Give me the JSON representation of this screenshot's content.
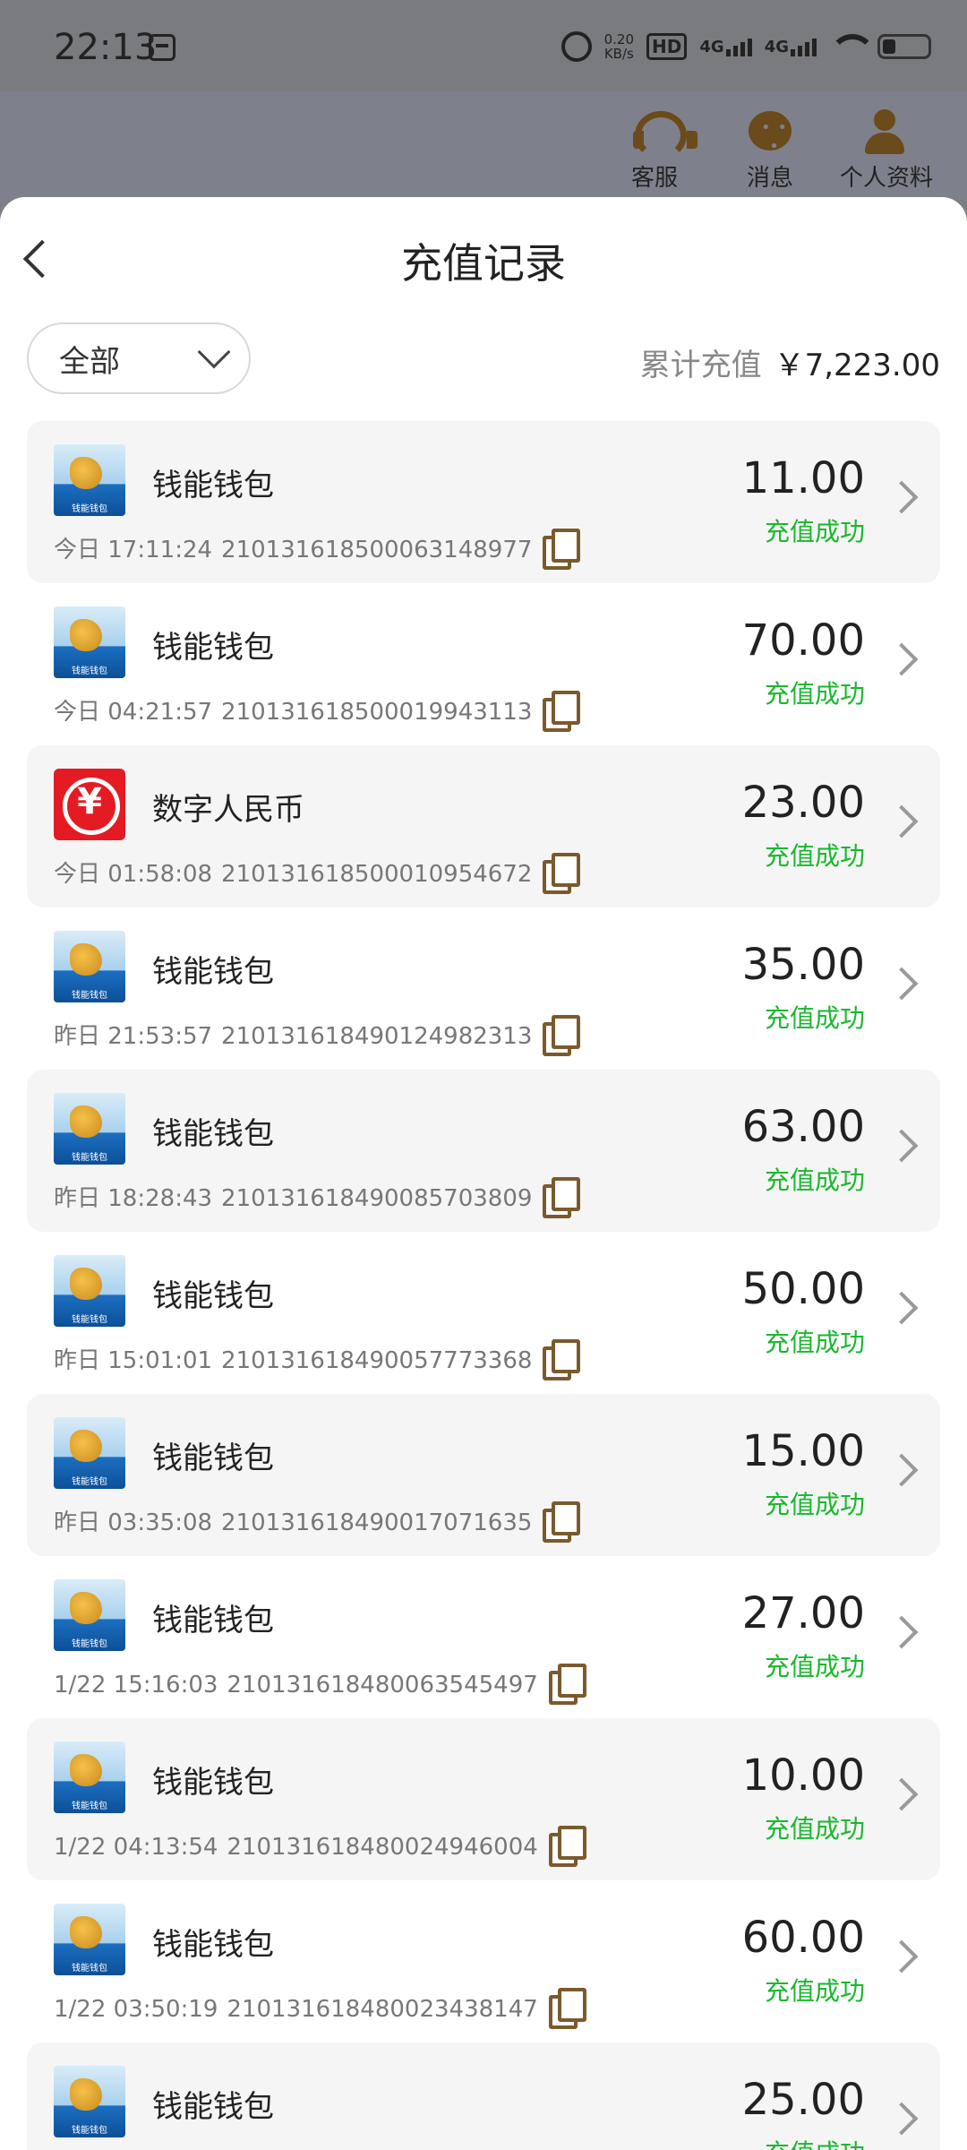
{
  "status_bar": {
    "time": "22:13",
    "net_speed": "0.20",
    "net_unit": "KB/s",
    "hd": "HD",
    "sim1": "4G",
    "sim2": "4G"
  },
  "top_nav": {
    "customer_service": "客服",
    "messages": "消息",
    "profile": "个人资料"
  },
  "sheet": {
    "title": "充值记录",
    "filter": {
      "selected": "全部"
    },
    "total": {
      "label": "累计充值",
      "value": "￥7,223.00"
    }
  },
  "records": [
    {
      "name": "钱能钱包",
      "logo": "wallet-logo",
      "time": "今日 17:11:24",
      "order_no": "21013161850006314897 7",
      "amount": "11.00",
      "status": "充值成功"
    },
    {
      "name": "钱能钱包",
      "logo": "wallet-logo",
      "time": "今日 04:21:57",
      "order_no": "210131618500019943113",
      "amount": "70.00",
      "status": "充值成功"
    },
    {
      "name": "数字人民币",
      "logo": "ecny-logo",
      "time": "今日 01:58:08",
      "order_no": "210131618500010954672",
      "amount": "23.00",
      "status": "充值成功"
    },
    {
      "name": "钱能钱包",
      "logo": "wallet-logo",
      "time": "昨日 21:53:57",
      "order_no": "210131618490124982313",
      "amount": "35.00",
      "status": "充值成功"
    },
    {
      "name": "钱能钱包",
      "logo": "wallet-logo",
      "time": "昨日 18:28:43",
      "order_no": "210131618490085703809",
      "amount": "63.00",
      "status": "充值成功"
    },
    {
      "name": "钱能钱包",
      "logo": "wallet-logo",
      "time": "昨日 15:01:01",
      "order_no": "210131618490057773368",
      "amount": "50.00",
      "status": "充值成功"
    },
    {
      "name": "钱能钱包",
      "logo": "wallet-logo",
      "time": "昨日 03:35:08",
      "order_no": "210131618490017071635",
      "amount": "15.00",
      "status": "充值成功"
    },
    {
      "name": "钱能钱包",
      "logo": "wallet-logo",
      "time": "1/22 15:16:03",
      "order_no": "210131618480063545497",
      "amount": "27.00",
      "status": "充值成功"
    },
    {
      "name": "钱能钱包",
      "logo": "wallet-logo",
      "time": "1/22 04:13:54",
      "order_no": "210131618480024946004",
      "amount": "10.00",
      "status": "充值成功"
    },
    {
      "name": "钱能钱包",
      "logo": "wallet-logo",
      "time": "1/22 03:50:19",
      "order_no": "210131618480023438147",
      "amount": "60.00",
      "status": "充值成功"
    },
    {
      "name": "钱能钱包",
      "logo": "wallet-logo",
      "time": "",
      "order_no": "",
      "amount": "25.00",
      "status": "充值成功"
    }
  ],
  "colors": {
    "success": "#18b82d",
    "copy_icon": "#7a5a2c",
    "ecny_red": "#e51b23"
  }
}
